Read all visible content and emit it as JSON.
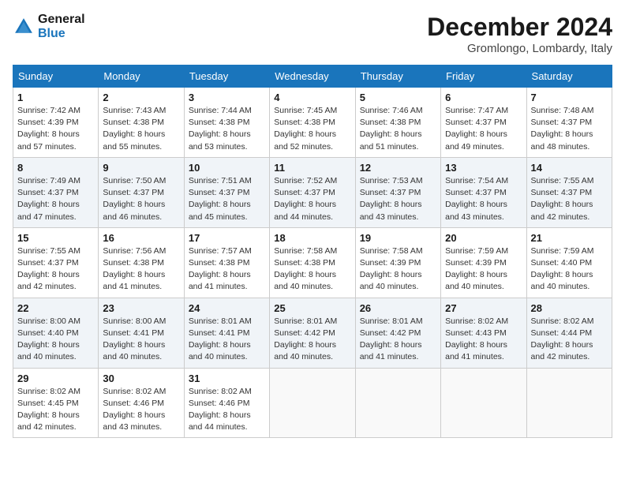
{
  "header": {
    "logo_line1": "General",
    "logo_line2": "Blue",
    "month_title": "December 2024",
    "location": "Gromlongo, Lombardy, Italy"
  },
  "weekdays": [
    "Sunday",
    "Monday",
    "Tuesday",
    "Wednesday",
    "Thursday",
    "Friday",
    "Saturday"
  ],
  "weeks": [
    [
      {
        "day": "1",
        "sunrise": "Sunrise: 7:42 AM",
        "sunset": "Sunset: 4:39 PM",
        "daylight": "Daylight: 8 hours and 57 minutes."
      },
      {
        "day": "2",
        "sunrise": "Sunrise: 7:43 AM",
        "sunset": "Sunset: 4:38 PM",
        "daylight": "Daylight: 8 hours and 55 minutes."
      },
      {
        "day": "3",
        "sunrise": "Sunrise: 7:44 AM",
        "sunset": "Sunset: 4:38 PM",
        "daylight": "Daylight: 8 hours and 53 minutes."
      },
      {
        "day": "4",
        "sunrise": "Sunrise: 7:45 AM",
        "sunset": "Sunset: 4:38 PM",
        "daylight": "Daylight: 8 hours and 52 minutes."
      },
      {
        "day": "5",
        "sunrise": "Sunrise: 7:46 AM",
        "sunset": "Sunset: 4:38 PM",
        "daylight": "Daylight: 8 hours and 51 minutes."
      },
      {
        "day": "6",
        "sunrise": "Sunrise: 7:47 AM",
        "sunset": "Sunset: 4:37 PM",
        "daylight": "Daylight: 8 hours and 49 minutes."
      },
      {
        "day": "7",
        "sunrise": "Sunrise: 7:48 AM",
        "sunset": "Sunset: 4:37 PM",
        "daylight": "Daylight: 8 hours and 48 minutes."
      }
    ],
    [
      {
        "day": "8",
        "sunrise": "Sunrise: 7:49 AM",
        "sunset": "Sunset: 4:37 PM",
        "daylight": "Daylight: 8 hours and 47 minutes."
      },
      {
        "day": "9",
        "sunrise": "Sunrise: 7:50 AM",
        "sunset": "Sunset: 4:37 PM",
        "daylight": "Daylight: 8 hours and 46 minutes."
      },
      {
        "day": "10",
        "sunrise": "Sunrise: 7:51 AM",
        "sunset": "Sunset: 4:37 PM",
        "daylight": "Daylight: 8 hours and 45 minutes."
      },
      {
        "day": "11",
        "sunrise": "Sunrise: 7:52 AM",
        "sunset": "Sunset: 4:37 PM",
        "daylight": "Daylight: 8 hours and 44 minutes."
      },
      {
        "day": "12",
        "sunrise": "Sunrise: 7:53 AM",
        "sunset": "Sunset: 4:37 PM",
        "daylight": "Daylight: 8 hours and 43 minutes."
      },
      {
        "day": "13",
        "sunrise": "Sunrise: 7:54 AM",
        "sunset": "Sunset: 4:37 PM",
        "daylight": "Daylight: 8 hours and 43 minutes."
      },
      {
        "day": "14",
        "sunrise": "Sunrise: 7:55 AM",
        "sunset": "Sunset: 4:37 PM",
        "daylight": "Daylight: 8 hours and 42 minutes."
      }
    ],
    [
      {
        "day": "15",
        "sunrise": "Sunrise: 7:55 AM",
        "sunset": "Sunset: 4:37 PM",
        "daylight": "Daylight: 8 hours and 42 minutes."
      },
      {
        "day": "16",
        "sunrise": "Sunrise: 7:56 AM",
        "sunset": "Sunset: 4:38 PM",
        "daylight": "Daylight: 8 hours and 41 minutes."
      },
      {
        "day": "17",
        "sunrise": "Sunrise: 7:57 AM",
        "sunset": "Sunset: 4:38 PM",
        "daylight": "Daylight: 8 hours and 41 minutes."
      },
      {
        "day": "18",
        "sunrise": "Sunrise: 7:58 AM",
        "sunset": "Sunset: 4:38 PM",
        "daylight": "Daylight: 8 hours and 40 minutes."
      },
      {
        "day": "19",
        "sunrise": "Sunrise: 7:58 AM",
        "sunset": "Sunset: 4:39 PM",
        "daylight": "Daylight: 8 hours and 40 minutes."
      },
      {
        "day": "20",
        "sunrise": "Sunrise: 7:59 AM",
        "sunset": "Sunset: 4:39 PM",
        "daylight": "Daylight: 8 hours and 40 minutes."
      },
      {
        "day": "21",
        "sunrise": "Sunrise: 7:59 AM",
        "sunset": "Sunset: 4:40 PM",
        "daylight": "Daylight: 8 hours and 40 minutes."
      }
    ],
    [
      {
        "day": "22",
        "sunrise": "Sunrise: 8:00 AM",
        "sunset": "Sunset: 4:40 PM",
        "daylight": "Daylight: 8 hours and 40 minutes."
      },
      {
        "day": "23",
        "sunrise": "Sunrise: 8:00 AM",
        "sunset": "Sunset: 4:41 PM",
        "daylight": "Daylight: 8 hours and 40 minutes."
      },
      {
        "day": "24",
        "sunrise": "Sunrise: 8:01 AM",
        "sunset": "Sunset: 4:41 PM",
        "daylight": "Daylight: 8 hours and 40 minutes."
      },
      {
        "day": "25",
        "sunrise": "Sunrise: 8:01 AM",
        "sunset": "Sunset: 4:42 PM",
        "daylight": "Daylight: 8 hours and 40 minutes."
      },
      {
        "day": "26",
        "sunrise": "Sunrise: 8:01 AM",
        "sunset": "Sunset: 4:42 PM",
        "daylight": "Daylight: 8 hours and 41 minutes."
      },
      {
        "day": "27",
        "sunrise": "Sunrise: 8:02 AM",
        "sunset": "Sunset: 4:43 PM",
        "daylight": "Daylight: 8 hours and 41 minutes."
      },
      {
        "day": "28",
        "sunrise": "Sunrise: 8:02 AM",
        "sunset": "Sunset: 4:44 PM",
        "daylight": "Daylight: 8 hours and 42 minutes."
      }
    ],
    [
      {
        "day": "29",
        "sunrise": "Sunrise: 8:02 AM",
        "sunset": "Sunset: 4:45 PM",
        "daylight": "Daylight: 8 hours and 42 minutes."
      },
      {
        "day": "30",
        "sunrise": "Sunrise: 8:02 AM",
        "sunset": "Sunset: 4:46 PM",
        "daylight": "Daylight: 8 hours and 43 minutes."
      },
      {
        "day": "31",
        "sunrise": "Sunrise: 8:02 AM",
        "sunset": "Sunset: 4:46 PM",
        "daylight": "Daylight: 8 hours and 44 minutes."
      },
      null,
      null,
      null,
      null
    ]
  ]
}
